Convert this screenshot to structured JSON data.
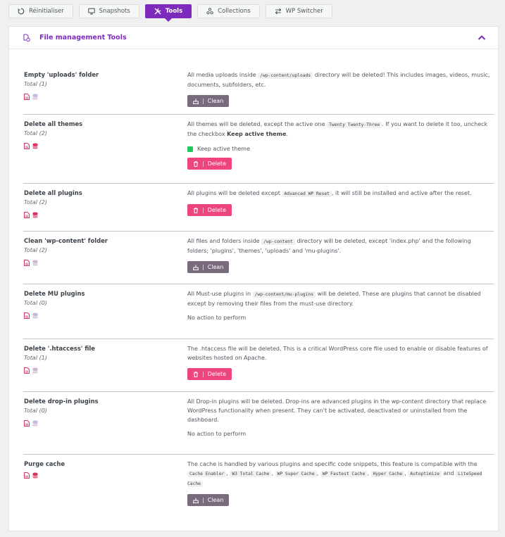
{
  "tabs": [
    {
      "label": "Réinitialiser",
      "icon": "reset-icon"
    },
    {
      "label": "Snapshots",
      "icon": "monitor-icon"
    },
    {
      "label": "Tools",
      "icon": "tools-icon"
    },
    {
      "label": "Collections",
      "icon": "collections-icon"
    },
    {
      "label": "WP Switcher",
      "icon": "switch-icon"
    }
  ],
  "panel": {
    "title": "File management Tools"
  },
  "labels": {
    "clean": "Clean",
    "delete": "Delete",
    "sep": "|",
    "no_action": "No action to perform",
    "keep_theme": "Keep active theme"
  },
  "rows": [
    {
      "name": "Empty 'uploads' folder",
      "total": "Total (1)",
      "d1": "All media uploads inside",
      "c1": "/wp-content/uploads",
      "d2": "directory will be deleted! This includes images, videos, music, documents, subfolders, etc."
    },
    {
      "name": "Delete all themes",
      "total": "Total (2)",
      "d1": "All themes will be deleted, except the active one",
      "c1": "Twenty Twenty-Three",
      "d2": ". If you want to delete it too, uncheck the checkbox",
      "b1": "Keep active theme",
      "d3": "."
    },
    {
      "name": "Delete all plugins",
      "total": "Total (2)",
      "d1": "All plugins will be deleted except",
      "c1": "Advanced WP Reset",
      "d2": ", it will still be installed and active after the reset."
    },
    {
      "name": "Clean 'wp-content' folder",
      "total": "Total (2)",
      "d1": "All files and folders inside",
      "c1": "/wp-content",
      "d2": "directory will be deleted, except 'index.php' and the following folders; 'plugins', 'themes', 'uploads' and 'mu-plugins'."
    },
    {
      "name": "Delete MU plugins",
      "total": "Total (0)",
      "d1": "All Must-use plugins in",
      "c1": "/wp-content/mu-plugins",
      "d2": "will be deleted. These are plugins that cannot be disabled except by removing their files from the must-use directory."
    },
    {
      "name": "Delete '.htaccess' file",
      "total": "Total (1)",
      "d1": "The .htaccess file will be deleted. This is a critical WordPress core file used to enable or disable features of websites hosted on Apache."
    },
    {
      "name": "Delete drop-in plugins",
      "total": "Total (0)",
      "d1": "All Drop-in plugins will be deleted. Drop-ins are advanced plugins in the wp-content directory that replace WordPress functionality when present. They can't be activated, deactivated or uninstalled from the dashboard."
    },
    {
      "name": "Purge cache",
      "d1": "The cache is handled by various plugins and specific code snippets, this feature is compatible with the",
      "caches": [
        "Cache Enabler",
        "W3 Total Cache",
        "WP Super Cache",
        "WP Fastest Cache",
        "Hyper Cache",
        "Autoptimize",
        "LiteSpeed Cache"
      ],
      "and": "and"
    }
  ],
  "colors": {
    "accent": "#7d2bbd",
    "clean": "#7a6a7d",
    "delete": "#ee4480",
    "icon_red": "#d63660",
    "icon_muted": "#c9b6d3",
    "check": "#22c55e"
  }
}
